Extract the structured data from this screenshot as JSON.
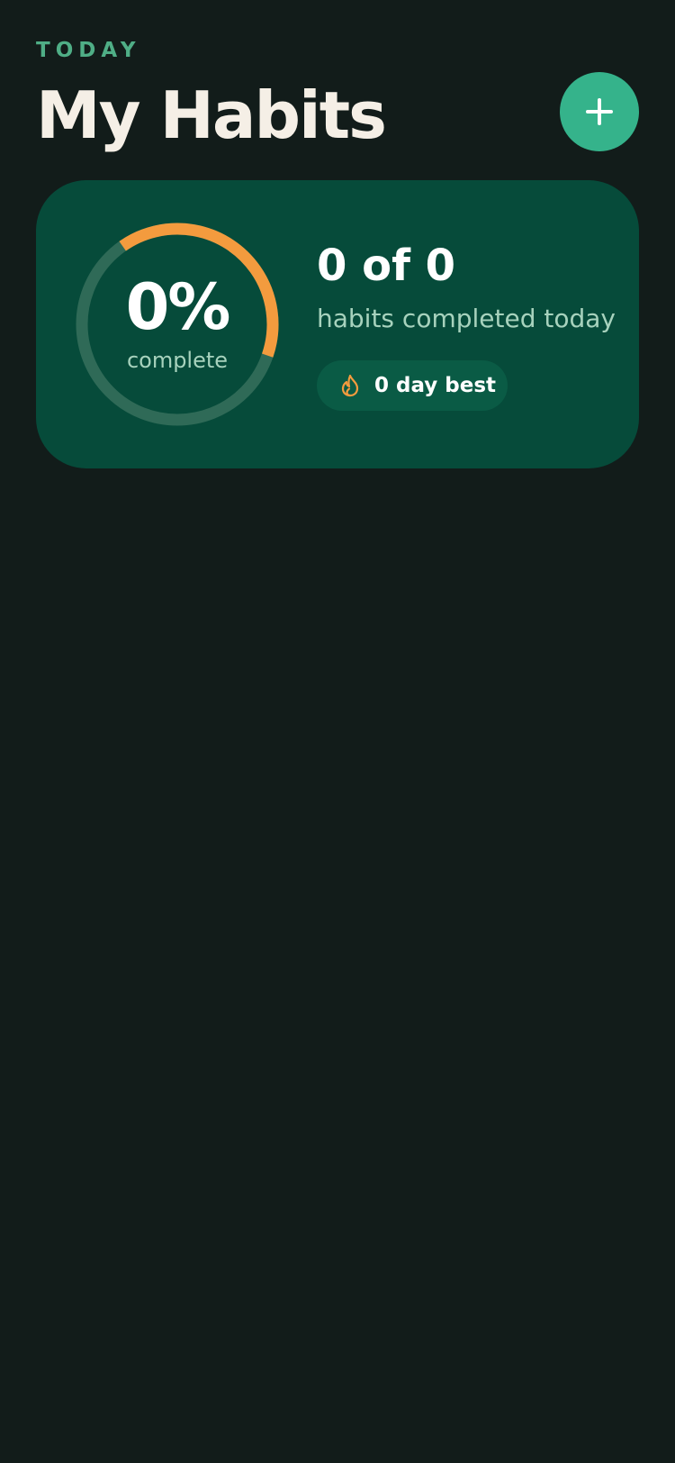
{
  "header": {
    "eyebrow": "TODAY",
    "title": "My Habits",
    "add_icon": "plus-icon"
  },
  "summary": {
    "percent_text": "0%",
    "percent_label": "complete",
    "progress_fraction": 0.4,
    "count_text": "0 of 0",
    "caption": "habits completed today",
    "streak_icon": "flame-icon",
    "streak_text": "0 day best"
  },
  "colors": {
    "background": "#121c1a",
    "card": "#064b3a",
    "accent": "#35b38b",
    "eyebrow": "#4fae86",
    "ring_progress": "#f39b3e",
    "ring_track": "#2f6a57",
    "muted_text": "#a7d2bd",
    "badge": "#0a5b45"
  }
}
